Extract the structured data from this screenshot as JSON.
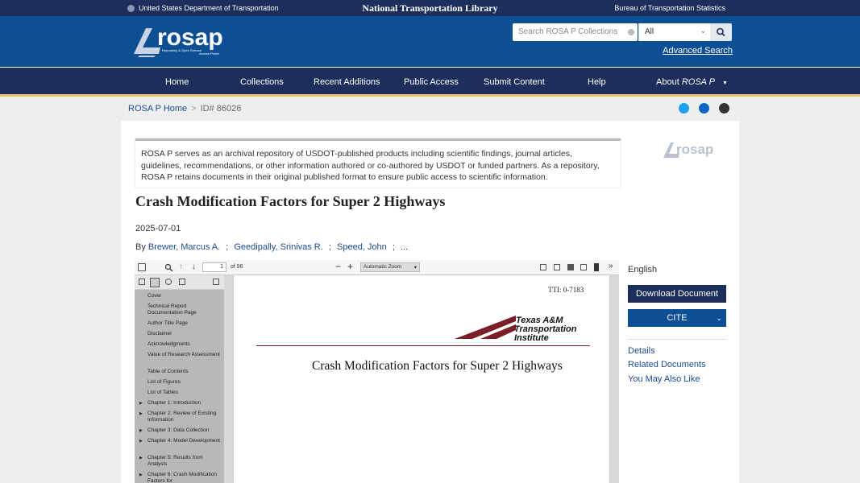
{
  "topbar": {
    "left": "United States Department of Transportation",
    "center": "National Transportation Library",
    "right": "Bureau of Transportation Statistics"
  },
  "logo": {
    "text": "rosap",
    "tagline1": "Repository & Open Science",
    "tagline2": "Access Portal"
  },
  "search": {
    "placeholder": "Search ROSA P Collections",
    "scope": "All",
    "advanced": "Advanced Search"
  },
  "nav": {
    "items": [
      "Home",
      "Collections",
      "Recent Additions",
      "Public Access",
      "Submit Content",
      "Help"
    ],
    "about": "About",
    "about_em": "ROSA P"
  },
  "breadcrumb": {
    "home": "ROSA P Home",
    "sep": ">",
    "id": "ID# 86026"
  },
  "notice": "ROSA P serves as an archival repository of USDOT-published products including scientific findings, journal articles, guidelines, recommendations, or other information authored or co-authored by USDOT or funded partners. As a repository, ROSA P retains documents in their original published format to ensure public access to scientific information.",
  "doc": {
    "title": "Crash Modification Factors for Super 2 Highways",
    "date": "2025-07-01",
    "by": "By",
    "authors": [
      "Brewer, Marcus A.",
      "Geedipally, Srinivas R.",
      "Speed, John"
    ],
    "sep": ";",
    "more": "..."
  },
  "viewer": {
    "page": "1",
    "of": "of 96",
    "zoom": "Automatic Zoom",
    "outline": [
      "Cover",
      "Technical Report Documentation Page",
      "Author Title Page",
      "Disclaimer",
      "Acknowledgments",
      "Value of Research Assessment",
      "Table of Contents",
      "List of Figures",
      "List of Tables",
      "Chapter 1: Introduction",
      "Chapter 2: Review of Existing Information",
      "Chapter 3: Data Collection",
      "Chapter 4: Model Development",
      "Chapter 5: Results from Analysis",
      "Chapter 6: Crash Modification Factors for"
    ],
    "page_id": "TTI: 0-7183",
    "tti1": "Texas A&M",
    "tti2": "Transportation",
    "tti3": "Institute",
    "page_title": "Crash Modification Factors for Super 2 Highways"
  },
  "side": {
    "language": "English",
    "download": "Download Document",
    "cite": "CITE",
    "links": [
      "Details",
      "Related Documents",
      "You May Also Like"
    ]
  },
  "colors": {
    "navy": "#1c2e5c",
    "blue": "#0d4f94",
    "gold": "#e7c46a",
    "link": "#1b4b8f",
    "maroon": "#7a1e2a"
  }
}
